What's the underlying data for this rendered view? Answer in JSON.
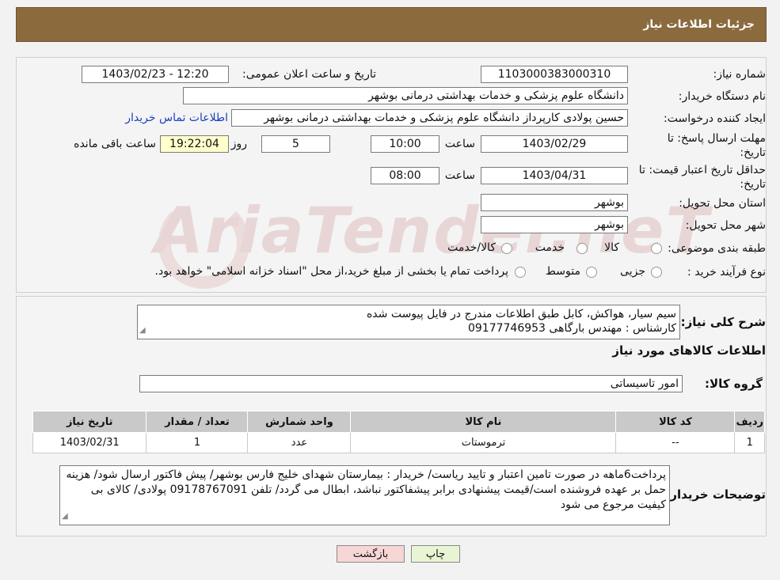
{
  "header": {
    "title": "جزئیات اطلاعات نیاز"
  },
  "form": {
    "need_number_label": "شماره نیاز:",
    "need_number": "1103000383000310",
    "announce_label": "تاریخ و ساعت اعلان عمومی:",
    "announce_value": "1403/02/23 - 12:20",
    "buyer_org_label": "نام دستگاه خریدار:",
    "buyer_org": "دانشگاه علوم پزشکی و خدمات بهداشتی درمانی بوشهر",
    "requester_label": "ایجاد کننده درخواست:",
    "requester": "حسین پولادی کارپرداز دانشگاه علوم پزشکی و خدمات بهداشتی درمانی بوشهر",
    "contact_link": "اطلاعات تماس خریدار",
    "deadline_label": "مهلت ارسال پاسخ: تا تاریخ:",
    "deadline_date": "1403/02/29",
    "time_label": "ساعت",
    "deadline_time": "10:00",
    "days_value": "5",
    "days_label": "روز و",
    "remaining_time": "19:22:04",
    "remaining_label": "ساعت باقی مانده",
    "validity_label": "حداقل تاریخ اعتبار قیمت: تا تاریخ:",
    "validity_date": "1403/04/31",
    "validity_time": "08:00",
    "province_label": "استان محل تحویل:",
    "province": "بوشهر",
    "city_label": "شهر محل تحویل:",
    "city": "بوشهر",
    "category_label": "طبقه بندی موضوعی:",
    "category_options": [
      "کالا",
      "خدمت",
      "کالا/خدمت"
    ],
    "process_label": "نوع فرآیند خرید :",
    "process_options": [
      "جزیی",
      "متوسط"
    ],
    "process_note": "پرداخت تمام یا بخشی از مبلغ خرید،از محل \"اسناد خزانه اسلامی\" خواهد بود."
  },
  "watermark": "AriaTender.neT",
  "details": {
    "summary_label": "شرح کلی نیاز:",
    "summary_line1": "سیم سیار، هواکش، کابل طبق اطلاعات مندرج در فایل پیوست شده",
    "summary_line2": "کارشناس : مهندس بارگاهی 09177746953",
    "goods_info_title": "اطلاعات کالاهای مورد نیاز",
    "goods_group_label": "گروه کالا:",
    "goods_group": "امور تاسیساتی",
    "table": {
      "headers": [
        "ردیف",
        "کد کالا",
        "نام کالا",
        "واحد شمارش",
        "تعداد / مقدار",
        "تاریخ نیاز"
      ],
      "rows": [
        [
          "1",
          "--",
          "ترموستات",
          "عدد",
          "1",
          "1403/02/31"
        ]
      ]
    },
    "buyer_notes_label": "توضیحات خریدار:",
    "buyer_notes": "پرداخت6ماهه در صورت تامین اعتبار و تایید ریاست/ خریدار : بیمارستان شهدای خلیج فارس بوشهر/ پیش فاکتور ارسال شود/ هزینه حمل بر عهده فروشنده است/قیمت پیشنهادی برابر پیشفاکتور نباشد، ابطال می گردد/ تلفن 09178767091 پولادی/ کالای بی کیفیت مرجوع می شود"
  },
  "buttons": {
    "print": "چاپ",
    "back": "بازگشت"
  }
}
